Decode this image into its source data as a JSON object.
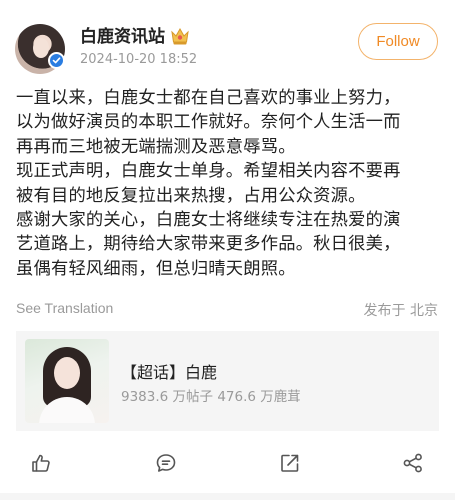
{
  "post": {
    "author": "白鹿资讯站",
    "timestamp": "2024-10-20 18:52",
    "follow_label": "Follow",
    "badge_icon": "crown-badge-icon",
    "lines": [
      "一直以来，白鹿女士都在自己喜欢的事业上努力，",
      "以为做好演员的本职工作就好。奈何个人生活一而",
      "再再而三地被无端揣测及恶意辱骂。",
      "现正式声明，白鹿女士单身。希望相关内容不要再",
      "被有目的地反复拉出来热搜，占用公众资源。",
      "感谢大家的关心，白鹿女士将继续专注在热爱的演",
      "艺道路上，期待给大家带来更多作品。秋日很美，",
      "虽偶有轻风细雨，但总归晴天朗照。"
    ],
    "translate_label": "See Translation",
    "location": "发布于 北京"
  },
  "card": {
    "title": "【超话】白鹿",
    "stats": "9383.6 万帖子 476.6 万鹿茸"
  },
  "actions": {
    "icons": [
      "like-icon",
      "comment-icon",
      "repost-icon",
      "share-icon"
    ]
  },
  "colors": {
    "accent": "#f08a25",
    "accent_border": "#f3b36b",
    "verified": "#2a7de1",
    "muted": "#9a9a9a"
  }
}
